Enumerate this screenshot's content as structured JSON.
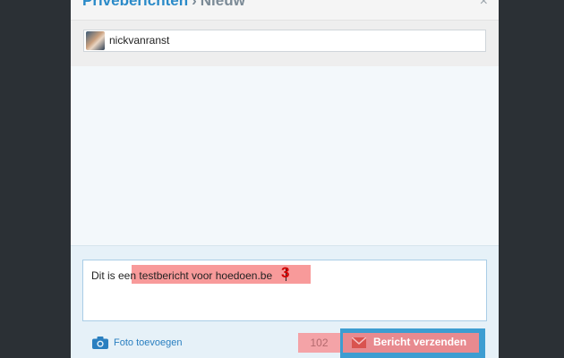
{
  "header": {
    "breadcrumb_link": "Privéberichten",
    "breadcrumb_separator": "›",
    "breadcrumb_current": "Nieuw",
    "close_symbol": "×"
  },
  "recipient": {
    "name": "nickvanranst"
  },
  "message": {
    "prefix": "Dit is ",
    "highlighted": "een testbericht voor hoedoen.be",
    "annotation": "3"
  },
  "footer": {
    "photo_label": "Foto toevoegen",
    "char_count": "102",
    "send_label": "Bericht verzenden"
  },
  "colors": {
    "accent": "#2a8ac8",
    "send_button": "#e88a8f",
    "annotation": "#d10000"
  },
  "icons": {
    "camera": "camera-icon",
    "mail": "mail-icon",
    "close": "close-icon"
  }
}
